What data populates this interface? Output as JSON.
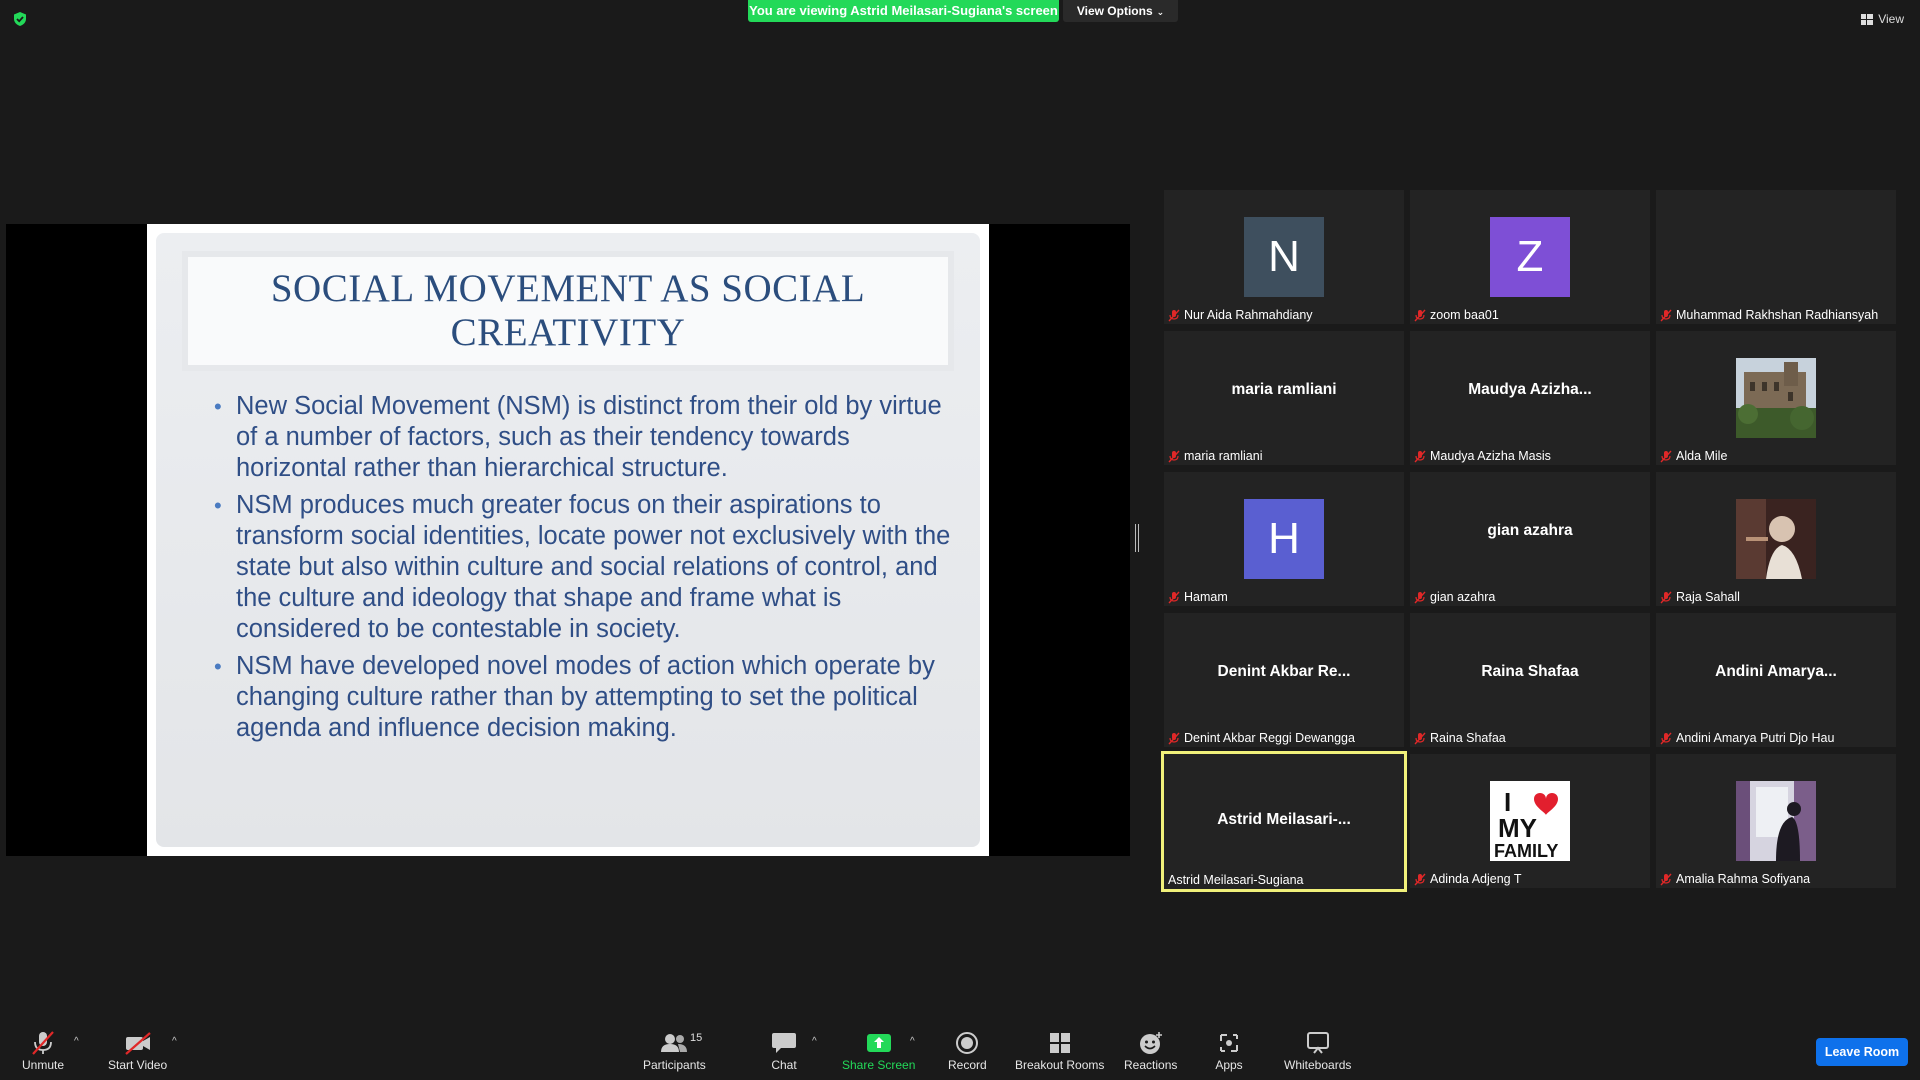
{
  "top": {
    "banner": "You are viewing Astrid Meilasari-Sugiana's screen",
    "view_options": "View Options",
    "view": "View"
  },
  "slide": {
    "title": "SOCIAL MOVEMENT AS SOCIAL CREATIVITY",
    "bullets": [
      "New Social Movement (NSM) is distinct from their old by virtue of a number of factors, such as their tendency towards horizontal rather than hierarchical structure.",
      "NSM produces much greater focus on their aspirations to transform social identities, locate power not exclusively with the state but also within culture and social relations of control, and the culture and ideology that shape and frame what is considered to be contestable in society.",
      "NSM have developed novel modes of action which operate by changing culture rather than by attempting to set the political agenda and influence decision making."
    ]
  },
  "participants": [
    {
      "name": "Nur Aida Rahmahdiany",
      "avatar_letter": "N",
      "avatar_color": "#3e4f5e"
    },
    {
      "name": "zoom baa01",
      "avatar_letter": "Z",
      "avatar_color": "#7e4fd6"
    },
    {
      "name": "Muhammad Rakhshan Radhiansyah"
    },
    {
      "name": "maria ramliani",
      "center": "maria ramliani"
    },
    {
      "name": "Maudya Azizha Masis",
      "center": "Maudya Azizha..."
    },
    {
      "name": "Alda Mile",
      "photo": "building"
    },
    {
      "name": "Hamam",
      "avatar_letter": "H",
      "avatar_color": "#5a5fd1"
    },
    {
      "name": "gian azahra",
      "center": "gian azahra"
    },
    {
      "name": "Raja Sahall",
      "photo": "portrait"
    },
    {
      "name": "Denint Akbar Reggi Dewangga",
      "center": "Denint Akbar Re..."
    },
    {
      "name": "Raina Shafaa",
      "center": "Raina Shafaa"
    },
    {
      "name": "Andini Amarya Putri Djo Hau",
      "center": "Andini Amarya..."
    },
    {
      "name": "Astrid Meilasari-Sugiana",
      "center": "Astrid Meilasari-..."
    },
    {
      "name": "Adinda Adjeng T",
      "photo": "family"
    },
    {
      "name": "Amalia Rahma Sofiyana",
      "photo": "window"
    }
  ],
  "photo_text": {
    "i": "I",
    "my": "MY",
    "family": "FAMILY"
  },
  "toolbar": {
    "unmute": "Unmute",
    "start_video": "Start Video",
    "participants": "Participants",
    "participants_count": "15",
    "chat": "Chat",
    "share_screen": "Share Screen",
    "record": "Record",
    "breakout_rooms": "Breakout Rooms",
    "reactions": "Reactions",
    "apps": "Apps",
    "whiteboards": "Whiteboards",
    "leave": "Leave Room"
  },
  "colors": {
    "share_green": "#23d959",
    "leave_blue": "#0e71eb",
    "active_speaker": "#f0f07a",
    "mic_off_red": "#e02828"
  }
}
